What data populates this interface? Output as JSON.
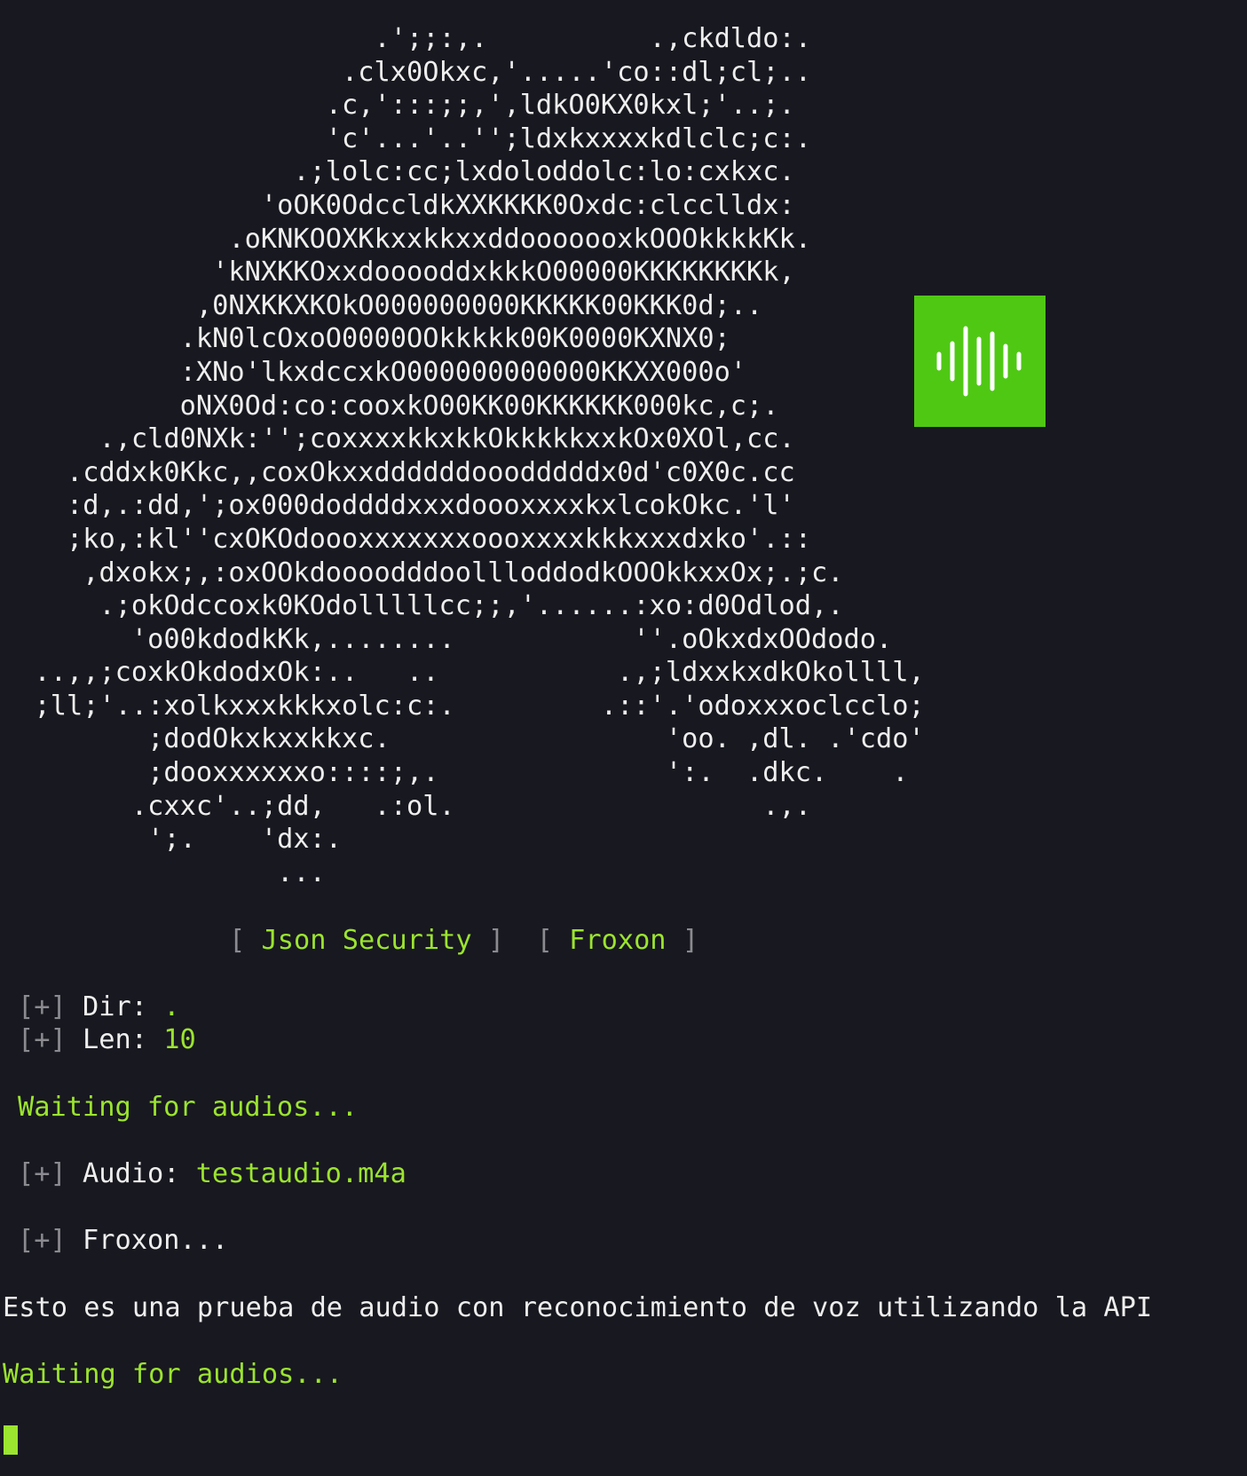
{
  "ascii_art": [
    "                       .';;:,.          .,ckdldo:.",
    "                     .clx0Okxc,'.....'co::dl;cl;..",
    "                    .c,':::;;,',ldkO0KX0kxl;'..;.",
    "                    'c'...'..'';ldxkxxxxkdlclc;c:.",
    "                  .;lolc:cc;lxdoloddolc:lo:cxkxc.",
    "                'oOK0OdccldkXXKKKK0Oxdc:clcclldx:",
    "              .oKNKOOXKkxxkkxxddooooooxkOOOkkkkKk.",
    "             'kNXKKOxxdooooddxkkkO00000KKKKKKKKk,",
    "            ,0NXKKXKOkO000000000KKKKK00KKK0d;..",
    "           .kN0lcOxoO0000OOkkkkk00K0000KXNX0;",
    "           :XNo'lkxdccxkO000000000000KKXX000o'",
    "           oNX0Od:co:cooxkO00KK00KKKKKK000kc,c;.",
    "      .,cld0NXk:'';coxxxxkkxkkOkkkkkxxkOx0XOl,cc.",
    "    .cddxk0Kkc,,coxOkxxddddddooodddddx0d'c0X0c.cc",
    "    :d,.:dd,';ox000doddddxxxdoooxxxxkxlcokOkc.'l'",
    "    ;ko,:kl''cxOKOdoooxxxxxxxoooxxxxkkkxxxdxko'.::",
    "     ,dxokx;,:oxOOkdoooodddoollloddodkOOOkkxxOx;.;c.",
    "      .;okOdccoxk0KOdolllllcc;;,'......:xo:d0Odlod,.",
    "        'o00kdodkKk,........           ''.oOkxdxOOdodo.",
    "  ..,,;coxkOkdodxOk:..   ..           .,;ldxxkxdkOkollll,",
    "  ;ll;'..:xolkxxxkkkxolc:c:.         .::'.'odoxxxoclcclo;",
    "         ;dodOkxkxxkkxc.                 'oo. ,dl. .'cdo'",
    "         ;dooxxxxxxo::::;,.              ':.  .dkc.    .",
    "        .cxxc'..;dd,   .:ol.                   .,.",
    "         ';.    'dx:.",
    "                 ..."
  ],
  "banner": {
    "open1": "[",
    "item1": "Json Security",
    "close1": "]",
    "open2": "[",
    "item2": "Froxon",
    "close2": "]"
  },
  "prefix": "[+]",
  "dir": {
    "label": "Dir:",
    "value": "."
  },
  "len": {
    "label": "Len:",
    "value": "10"
  },
  "waiting1": "Waiting for audios...",
  "audio": {
    "label": "Audio:",
    "value": "testaudio.m4a"
  },
  "froxon": "Froxon...",
  "transcript": "Esto es una prueba de audio con reconocimiento de voz utilizando la API",
  "waiting2": "Waiting for audios...",
  "colors": {
    "background": "#181820",
    "text": "#eeeeee",
    "accent_green": "#9be42f",
    "logo_green": "#4fc814",
    "bracket_gray": "#8a8a90"
  },
  "logo_icon": "audio-wave-icon"
}
